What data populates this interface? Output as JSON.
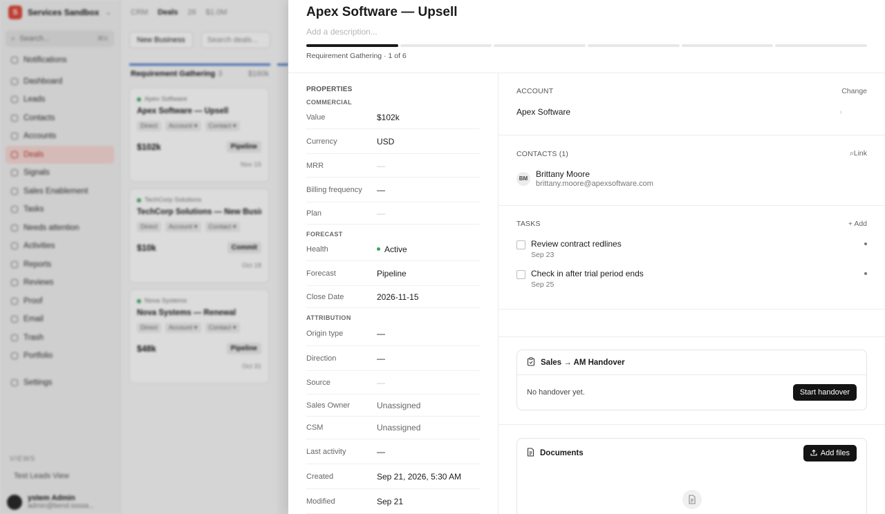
{
  "sidebar": {
    "workspace": "Services Sandbox",
    "logo": "S",
    "search_placeholder": "Search...",
    "search_shortcut": "⌘K",
    "notifications": "Notifications",
    "items": [
      {
        "label": "Dashboard",
        "icon": "dashboard-icon"
      },
      {
        "label": "Leads",
        "icon": "leads-icon"
      },
      {
        "label": "Contacts",
        "icon": "contacts-icon"
      },
      {
        "label": "Accounts",
        "icon": "accounts-icon"
      },
      {
        "label": "Deals",
        "icon": "deals-icon",
        "active": true
      },
      {
        "label": "Signals",
        "icon": "signals-icon"
      },
      {
        "label": "Sales Enablement",
        "icon": "enablement-icon"
      },
      {
        "label": "Tasks",
        "icon": "tasks-icon"
      },
      {
        "label": "Needs attention",
        "icon": "attention-icon"
      },
      {
        "label": "Activities",
        "icon": "activities-icon"
      },
      {
        "label": "Reports",
        "icon": "reports-icon"
      },
      {
        "label": "Reviews",
        "icon": "reviews-icon"
      },
      {
        "label": "Proof",
        "icon": "proof-icon"
      },
      {
        "label": "Email",
        "icon": "email-icon"
      },
      {
        "label": "Trash",
        "icon": "trash-icon"
      },
      {
        "label": "Portfolio",
        "icon": "portfolio-icon"
      }
    ],
    "settings": "Settings",
    "views_label": "VIEWS",
    "view_item": "Test Leads View",
    "user_name": "ystem Admin",
    "user_email": "admin@bend.ssssa..."
  },
  "board": {
    "crumbs": [
      "CRM",
      "Deals",
      "26",
      "$1.0M"
    ],
    "new_button": "New Business",
    "search_placeholder": "Search deals...",
    "column": {
      "title": "Requirement Gathering",
      "count": "3",
      "sum": "$160k"
    },
    "cards": [
      {
        "org": "Apex Software",
        "title": "Apex Software — Upsell",
        "chips": [
          "Direct",
          "Account ▾",
          "Contact ▾"
        ],
        "amount": "$102k",
        "stage": "Pipeline",
        "due": "Nov 15"
      },
      {
        "org": "TechCorp Solutions",
        "title": "TechCorp Solutions — New Busin...",
        "chips": [
          "Direct",
          "Account ▾",
          "Contact ▾"
        ],
        "amount": "$10k",
        "stage": "Commit",
        "due": "Oct 18"
      },
      {
        "org": "Nova Systems",
        "title": "Nova Systems — Renewal",
        "chips": [
          "Direct",
          "Account ▾",
          "Contact ▾"
        ],
        "amount": "$48k",
        "stage": "Pipeline",
        "due": "Oct 31"
      }
    ]
  },
  "deal": {
    "title": "Apex Software — Upsell",
    "description_placeholder": "Add a description...",
    "stage_text": "Requirement Gathering · 1 of 6",
    "stage_progress": {
      "current": 1,
      "total": 6
    },
    "properties_label": "PROPERTIES",
    "commercial_label": "COMMERCIAL",
    "commercial": [
      {
        "key": "Value",
        "value": "$102k",
        "style": "normal"
      },
      {
        "key": "Currency",
        "value": "USD",
        "style": "normal"
      },
      {
        "key": "MRR",
        "value": "—",
        "style": "muted"
      },
      {
        "key": "Billing frequency",
        "value": "—",
        "style": "dash"
      },
      {
        "key": "Plan",
        "value": "—",
        "style": "muted"
      }
    ],
    "forecast_label": "FORECAST",
    "forecast": [
      {
        "key": "Health",
        "value": "Active",
        "style": "health"
      },
      {
        "key": "Forecast",
        "value": "Pipeline",
        "style": "normal"
      },
      {
        "key": "Close Date",
        "value": "2026-11-15",
        "style": "normal"
      }
    ],
    "attribution_label": "ATTRIBUTION",
    "attribution": [
      {
        "key": "Origin type",
        "value": "—",
        "style": "dash"
      },
      {
        "key": "Direction",
        "value": "—",
        "style": "dash"
      },
      {
        "key": "Source",
        "value": "—",
        "style": "muted"
      },
      {
        "key": "Sales Owner",
        "value": "Unassigned",
        "style": "gray"
      },
      {
        "key": "CSM",
        "value": "Unassigned",
        "style": "gray"
      },
      {
        "key": "Last activity",
        "value": "—",
        "style": "dash"
      },
      {
        "key": "Created",
        "value": "Sep 21, 2026, 5:30 AM",
        "style": "normal"
      },
      {
        "key": "Modified",
        "value": "Sep 21",
        "style": "normal"
      }
    ],
    "account": {
      "label": "ACCOUNT",
      "action": "Change",
      "name": "Apex Software"
    },
    "contacts": {
      "label": "CONTACTS (1)",
      "action": "Link",
      "items": [
        {
          "initials": "BM",
          "name": "Brittany Moore",
          "email": "brittany.moore@apexsoftware.com"
        }
      ]
    },
    "tasks": {
      "label": "TASKS",
      "action": "+ Add",
      "items": [
        {
          "name": "Review contract redlines",
          "date": "Sep 23"
        },
        {
          "name": "Check in after trial period ends",
          "date": "Sep 25"
        }
      ]
    },
    "handover": {
      "title": "Sales → AM Handover",
      "empty_text": "No handover yet.",
      "button": "Start handover"
    },
    "documents": {
      "title": "Documents",
      "button": "Add files"
    }
  }
}
